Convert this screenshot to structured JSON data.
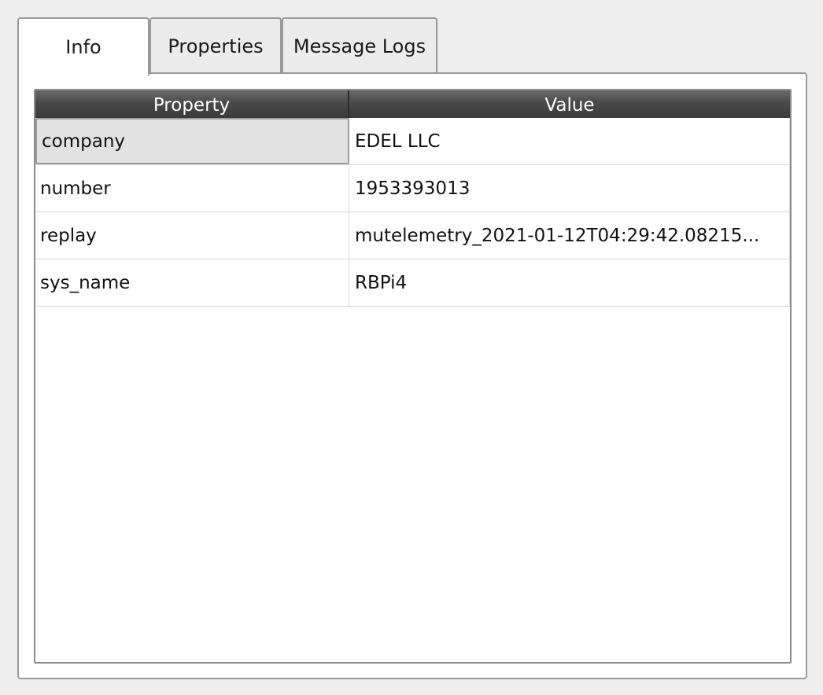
{
  "tabs": [
    {
      "label": "Info",
      "active": true
    },
    {
      "label": "Properties",
      "active": false
    },
    {
      "label": "Message Logs",
      "active": false
    }
  ],
  "table": {
    "columns": [
      "Property",
      "Value"
    ],
    "rows": [
      {
        "property": "company",
        "value": "EDEL LLC"
      },
      {
        "property": "number",
        "value": "1953393013"
      },
      {
        "property": "replay",
        "value": "mutelemetry_2021-01-12T04:29:42.08215..."
      },
      {
        "property": "sys_name",
        "value": "RBPi4"
      }
    ],
    "selected_row": 0
  }
}
